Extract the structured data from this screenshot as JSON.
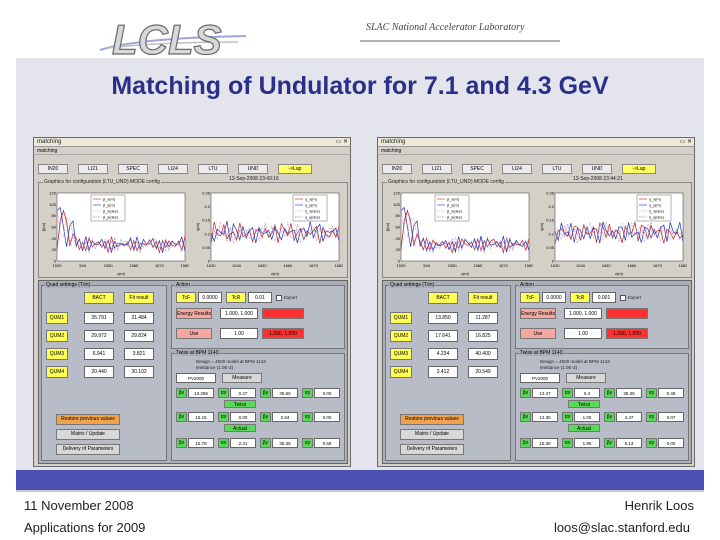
{
  "header": {
    "logo_text": "LCLS",
    "lab_name": "SLAC National Accelerator Laboratory"
  },
  "title": "Matching of Undulator for 7.1 and 4.3 GeV",
  "footer": {
    "date": "11 November 2008",
    "subtitle": "Applications for 2009",
    "author": "Henrik Loos",
    "email": "loos@slac.stanford.edu"
  },
  "colors": {
    "title": "#2a2f8a",
    "slide_bg": "#e4e5ec",
    "bar": "#4a4fb0",
    "yellow_button": "#ffff55",
    "red_field": "#ff3030",
    "green_box": "#58d858"
  },
  "windows": [
    {
      "title": "matching",
      "menu": "matching",
      "toolbar": [
        "IN20",
        "LI21",
        "SPEC",
        "LI24",
        "LTU",
        "UND",
        "->Lap"
      ],
      "timestamp": "13-Sep-2008 23:43:16",
      "plot_group_label": "Graphics for configuration (LTU_UND) MODE config",
      "plot1": {
        "ylabel": "β(m)",
        "xlabel": "z(m)",
        "ylim": [
          0,
          120
        ],
        "yticks": [
          0,
          20,
          40,
          60,
          80,
          100,
          120
        ],
        "xticks": [
          "1530",
          "540",
          "1550",
          "1560",
          "1570",
          "1580"
        ],
        "legend": [
          "β_x(m)",
          "β_y(m)",
          "β_x(des)",
          "β_y(des)"
        ]
      },
      "plot2": {
        "ylabel": "η(m)",
        "xlabel": "z(m)",
        "yticks": [
          0,
          0.05,
          0.1,
          0.15,
          0.2,
          0.25
        ],
        "xticks": [
          "1630",
          "1640",
          "1650",
          "1660",
          "1670",
          "1680"
        ],
        "legend": [
          "η_x(m)",
          "η_y(m)",
          "η_x(des)",
          "η_y(des)"
        ]
      },
      "used_group_label": "Quad settings (T/m)",
      "used_headers": [
        "BACT",
        "Fit result"
      ],
      "quads": [
        {
          "name": "QUM1",
          "bact": "35.791",
          "fit": "31.484"
        },
        {
          "name": "QUM2",
          "bact": "29.972",
          "fit": "29.824"
        },
        {
          "name": "QUM3",
          "bact": "6.941",
          "fit": "3.821"
        },
        {
          "name": "QUM4",
          "bact": "20.440",
          "fit": "30.102"
        }
      ],
      "action_label": "Action",
      "action_items": [
        "TcF",
        "0.0000",
        "TcR",
        "0.01",
        "Export"
      ],
      "energy_label": "Energy Results",
      "energy_value": "1.000, 1.000",
      "use_label": "Use",
      "use_value": "1.00",
      "use_red": "1.000, 1.000",
      "solve_label": "Twiss at BPM 1143",
      "solve_text1": "Design = 4500 model at BPM 1143",
      "solve_text2": "emittance (1.0E-3)",
      "solve_select": "PV2000",
      "solve_btn": "Measure",
      "twiss_label": "Twiss",
      "twiss_top": [
        "βx",
        "13.256",
        "αx",
        "0.27",
        "βy",
        "35.60",
        "αy",
        "0.00"
      ],
      "actual_label": "Actual",
      "twiss_mid": [
        "βx",
        "15.15",
        "αx",
        "0.00",
        "βy",
        "2.84",
        "αy",
        "0.00"
      ],
      "twiss_bot": [
        "βx",
        "15.78",
        "αx",
        "2.41",
        "βy",
        "35.35",
        "αy",
        "0.68"
      ],
      "buttons": [
        "Restore previous values",
        "Matrix / Update",
        "Delivery of Parameters"
      ]
    },
    {
      "title": "matching",
      "menu": "matching",
      "toolbar": [
        "IN20",
        "LI21",
        "SPEC",
        "LI24",
        "LTU",
        "UND",
        "->Lap"
      ],
      "timestamp": "13-Sep-2008 23:44:21",
      "plot_group_label": "Graphics for configuration (LTU_UND) MODE config",
      "plot1": {
        "ylabel": "β(m)",
        "xlabel": "z(m)",
        "ylim": [
          0,
          120
        ],
        "yticks": [
          0,
          20,
          40,
          60,
          80,
          100,
          120
        ],
        "xticks": [
          "1530",
          "540",
          "1550",
          "1560",
          "1570",
          "1580"
        ],
        "legend": [
          "β_x(m)",
          "β_y(m)",
          "β_x(des)",
          "β_y(des)"
        ]
      },
      "plot2": {
        "ylabel": "η(m)",
        "xlabel": "z(m)",
        "yticks": [
          0,
          0.05,
          0.1,
          0.15,
          0.2,
          0.25
        ],
        "xticks": [
          "1630",
          "1640",
          "1650",
          "1660",
          "1670",
          "1680"
        ],
        "legend": [
          "η_x(m)",
          "η_y(m)",
          "η_x(des)",
          "η_y(des)"
        ]
      },
      "used_group_label": "Quad settings (T/m)",
      "used_headers": [
        "BACT",
        "Fit result"
      ],
      "quads": [
        {
          "name": "QUM1",
          "bact": "13.850",
          "fit": "11.287"
        },
        {
          "name": "QUM2",
          "bact": "17.641",
          "fit": "16.825"
        },
        {
          "name": "QUM3",
          "bact": "4.234",
          "fit": "40.400"
        },
        {
          "name": "QUM4",
          "bact": "3.412",
          "fit": "20.549"
        }
      ],
      "action_label": "Action",
      "action_items": [
        "TcF",
        "0.0000",
        "TcR",
        "0.001",
        "Export"
      ],
      "energy_label": "Energy Results",
      "energy_value": "1.000, 1.000",
      "use_label": "Use",
      "use_value": "1.00",
      "use_red": "1.000, 1.000",
      "solve_label": "Twiss at BPM 1143",
      "solve_text1": "Design = 4500 model at BPM 1143",
      "solve_text2": "emittance (1.0E-3)",
      "solve_select": "PV2000",
      "solve_btn": "Measure",
      "twiss_label": "Twiss",
      "twiss_top": [
        "βx",
        "13.47",
        "αx",
        "0.4",
        "βy",
        "35.35",
        "αy",
        "0.48"
      ],
      "actual_label": "Actual",
      "twiss_mid": [
        "βx",
        "13.35",
        "αx",
        "1.00",
        "βy",
        "4.47",
        "αy",
        "0.07"
      ],
      "twiss_bot": [
        "βx",
        "15.38",
        "αx",
        "1.95",
        "βy",
        "5.13",
        "αy",
        "0.00"
      ],
      "buttons": [
        "Restore previous values",
        "Matrix / Update",
        "Delivery of Parameters"
      ]
    }
  ]
}
